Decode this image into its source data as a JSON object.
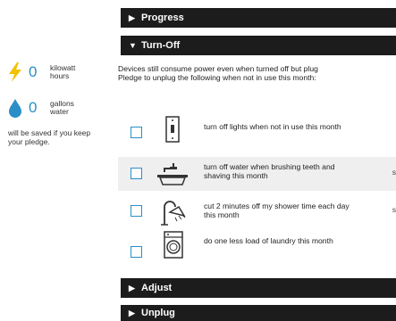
{
  "savings": {
    "kwh_value": "0",
    "kwh_unit": "kilowatt hours",
    "gallons_value": "0",
    "gallons_unit": "gallons water",
    "note": "will be saved if you keep your pledge.",
    "lightning_color": "#f2c200",
    "water_color": "#2a8fc7"
  },
  "sections": {
    "progress": "Progress",
    "turnoff": "Turn-Off",
    "adjust": "Adjust",
    "unplug": "Unplug"
  },
  "turnoff": {
    "intro_line1": "Devices still consume power even when turned off but plug",
    "intro_line2": "Pledge to unplug the following when not in use this month:"
  },
  "pledges": [
    {
      "icon": "light-switch-icon",
      "text": "turn off lights when not in use this month",
      "tail": ""
    },
    {
      "icon": "faucet-icon",
      "text": "turn off water when brushing teeth and shaving this month",
      "tail": "s"
    },
    {
      "icon": "shower-head-icon",
      "text": "cut 2 minutes off my shower time each day this month",
      "tail": "s"
    },
    {
      "icon": "washing-machine-icon",
      "text": "do one less load of laundry this month",
      "tail": ""
    }
  ]
}
